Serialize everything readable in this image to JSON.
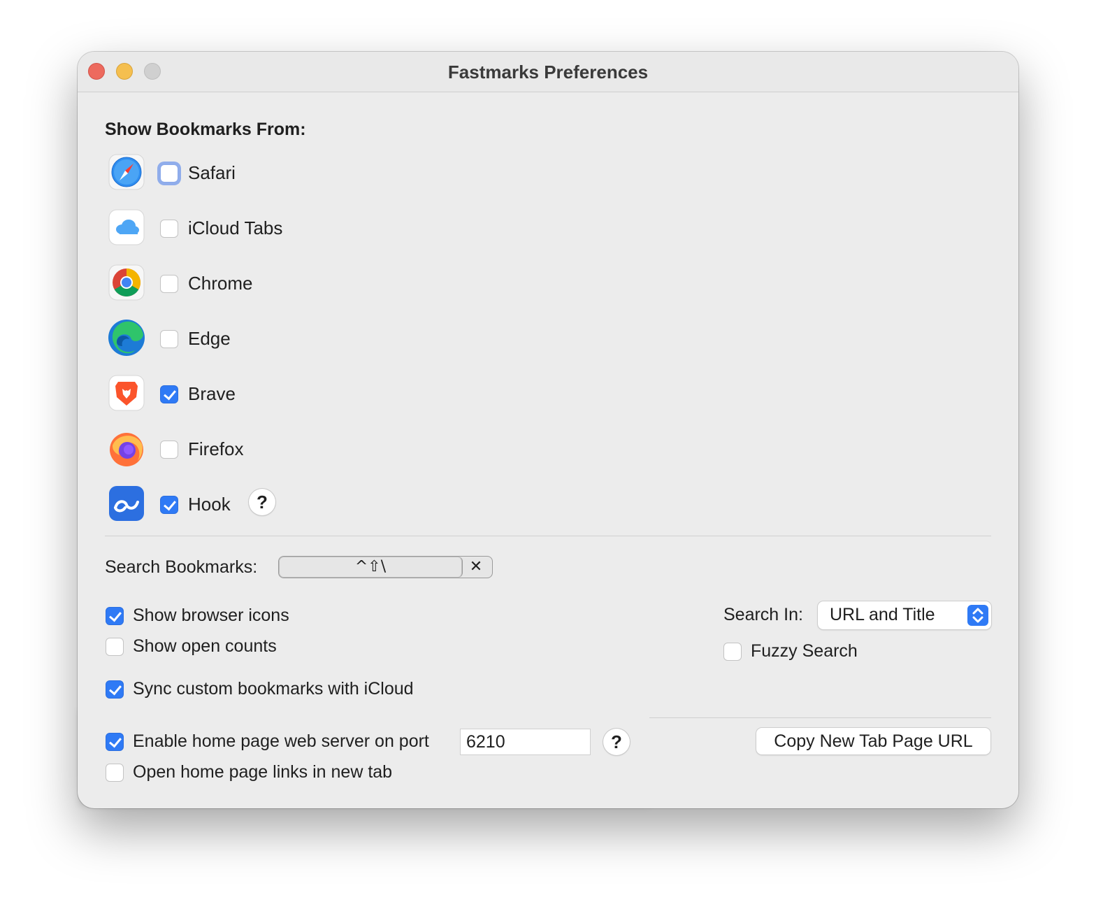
{
  "window": {
    "title": "Fastmarks Preferences"
  },
  "bookmarks_section": {
    "title": "Show Bookmarks From:",
    "browsers": [
      {
        "label": "Safari",
        "checked": false,
        "focused": true,
        "icon": "safari-icon"
      },
      {
        "label": "iCloud Tabs",
        "checked": false,
        "icon": "icloud-icon"
      },
      {
        "label": "Chrome",
        "checked": false,
        "icon": "chrome-icon"
      },
      {
        "label": "Edge",
        "checked": false,
        "icon": "edge-icon"
      },
      {
        "label": "Brave",
        "checked": true,
        "icon": "brave-icon"
      },
      {
        "label": "Firefox",
        "checked": false,
        "icon": "firefox-icon"
      },
      {
        "label": "Hook",
        "checked": true,
        "icon": "hook-icon"
      }
    ],
    "hook_help": "?"
  },
  "search_bookmarks": {
    "label": "Search Bookmarks:",
    "shortcut": "^⇧\\",
    "clear": "✕"
  },
  "options": {
    "show_browser_icons": {
      "label": "Show browser icons",
      "checked": true
    },
    "show_open_counts": {
      "label": "Show open counts",
      "checked": false
    },
    "sync_icloud": {
      "label": "Sync custom bookmarks with iCloud",
      "checked": true
    }
  },
  "search_in": {
    "label": "Search In:",
    "value": "URL and Title",
    "fuzzy": {
      "label": "Fuzzy Search",
      "checked": false
    }
  },
  "home_page": {
    "enable_label": "Enable home page web server on port",
    "enable_checked": true,
    "port": "6210",
    "help": "?",
    "new_tab_label": "Open home page links in new tab",
    "new_tab_checked": false,
    "copy_button": "Copy New Tab Page URL"
  },
  "colors": {
    "accent": "#2f7af5",
    "highlight": "#fbf600",
    "window_bg": "#ececec"
  }
}
